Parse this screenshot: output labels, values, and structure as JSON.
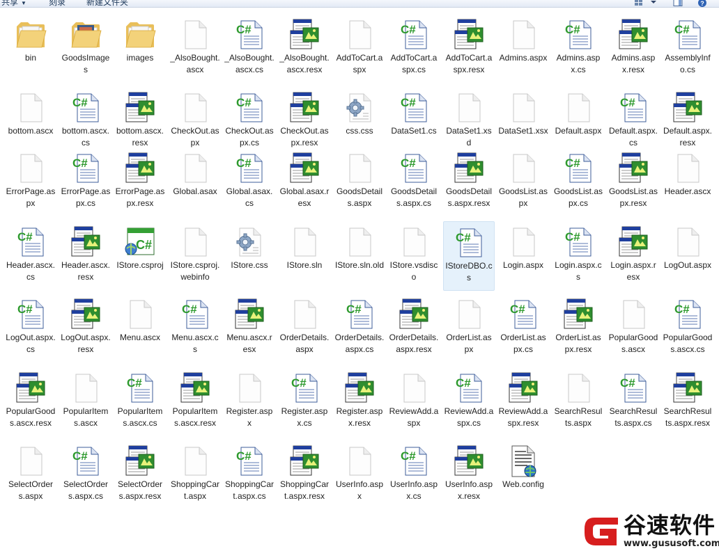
{
  "toolbar": {
    "share_label": "共享",
    "burn_label": "刻录",
    "new_folder_label": "新建文件夹"
  },
  "colors": {
    "csharp_green": "#2e9a2e",
    "resx_blue": "#1f3f9e",
    "folder_yellow": "#f3d27a",
    "selection_bg": "#e5f1fb"
  },
  "files": [
    {
      "name": "bin",
      "icon": "folder-icon"
    },
    {
      "name": "GoodsImages",
      "icon": "folder-icon"
    },
    {
      "name": "images",
      "icon": "folder-icon"
    },
    {
      "name": "_AlsoBought.ascx",
      "icon": "blank-file-icon"
    },
    {
      "name": "_AlsoBought.ascx.cs",
      "icon": "csharp-file-icon"
    },
    {
      "name": "_AlsoBought.ascx.resx",
      "icon": "resx-file-icon"
    },
    {
      "name": "AddToCart.aspx",
      "icon": "blank-file-icon"
    },
    {
      "name": "AddToCart.aspx.cs",
      "icon": "csharp-file-icon"
    },
    {
      "name": "AddToCart.aspx.resx",
      "icon": "resx-file-icon"
    },
    {
      "name": "Admins.aspx",
      "icon": "blank-file-icon"
    },
    {
      "name": "Admins.aspx.cs",
      "icon": "csharp-file-icon"
    },
    {
      "name": "Admins.aspx.resx",
      "icon": "resx-file-icon"
    },
    {
      "name": "AssemblyInfo.cs",
      "icon": "csharp-file-icon"
    },
    {
      "name": "bottom.ascx",
      "icon": "blank-file-icon"
    },
    {
      "name": "bottom.ascx.cs",
      "icon": "csharp-file-icon"
    },
    {
      "name": "bottom.ascx.resx",
      "icon": "resx-file-icon"
    },
    {
      "name": "CheckOut.aspx",
      "icon": "blank-file-icon"
    },
    {
      "name": "CheckOut.aspx.cs",
      "icon": "csharp-file-icon"
    },
    {
      "name": "CheckOut.aspx.resx",
      "icon": "resx-file-icon"
    },
    {
      "name": "css.css",
      "icon": "css-gear-icon"
    },
    {
      "name": "DataSet1.cs",
      "icon": "csharp-file-icon"
    },
    {
      "name": "DataSet1.xsd",
      "icon": "blank-file-icon"
    },
    {
      "name": "DataSet1.xsx",
      "icon": "blank-file-icon"
    },
    {
      "name": "Default.aspx",
      "icon": "blank-file-icon"
    },
    {
      "name": "Default.aspx.cs",
      "icon": "csharp-file-icon"
    },
    {
      "name": "Default.aspx.resx",
      "icon": "resx-file-icon"
    },
    {
      "name": "ErrorPage.aspx",
      "icon": "blank-file-icon"
    },
    {
      "name": "ErrorPage.aspx.cs",
      "icon": "csharp-file-icon"
    },
    {
      "name": "ErrorPage.aspx.resx",
      "icon": "resx-file-icon"
    },
    {
      "name": "Global.asax",
      "icon": "blank-file-icon"
    },
    {
      "name": "Global.asax.cs",
      "icon": "csharp-file-icon"
    },
    {
      "name": "Global.asax.resx",
      "icon": "resx-file-icon"
    },
    {
      "name": "GoodsDetails.aspx",
      "icon": "blank-file-icon"
    },
    {
      "name": "GoodsDetails.aspx.cs",
      "icon": "csharp-file-icon"
    },
    {
      "name": "GoodsDetails.aspx.resx",
      "icon": "resx-file-icon"
    },
    {
      "name": "GoodsList.aspx",
      "icon": "blank-file-icon"
    },
    {
      "name": "GoodsList.aspx.cs",
      "icon": "csharp-file-icon"
    },
    {
      "name": "GoodsList.aspx.resx",
      "icon": "resx-file-icon"
    },
    {
      "name": "Header.ascx",
      "icon": "blank-file-icon"
    },
    {
      "name": "Header.ascx.cs",
      "icon": "csharp-file-icon"
    },
    {
      "name": "Header.ascx.resx",
      "icon": "resx-file-icon"
    },
    {
      "name": "IStore.csproj",
      "icon": "csproj-icon"
    },
    {
      "name": "IStore.csproj.webinfo",
      "icon": "blank-file-icon"
    },
    {
      "name": "IStore.css",
      "icon": "css-gear-icon"
    },
    {
      "name": "IStore.sln",
      "icon": "blank-file-icon"
    },
    {
      "name": "IStore.sln.old",
      "icon": "blank-file-icon"
    },
    {
      "name": "IStore.vsdisco",
      "icon": "blank-file-icon"
    },
    {
      "name": "IStoreDBO.cs",
      "icon": "csharp-file-icon",
      "selected": true
    },
    {
      "name": "Login.aspx",
      "icon": "blank-file-icon"
    },
    {
      "name": "Login.aspx.cs",
      "icon": "csharp-file-icon"
    },
    {
      "name": "Login.aspx.resx",
      "icon": "resx-file-icon"
    },
    {
      "name": "LogOut.aspx",
      "icon": "blank-file-icon"
    },
    {
      "name": "LogOut.aspx.cs",
      "icon": "csharp-file-icon"
    },
    {
      "name": "LogOut.aspx.resx",
      "icon": "resx-file-icon"
    },
    {
      "name": "Menu.ascx",
      "icon": "blank-file-icon"
    },
    {
      "name": "Menu.ascx.cs",
      "icon": "csharp-file-icon"
    },
    {
      "name": "Menu.ascx.resx",
      "icon": "resx-file-icon"
    },
    {
      "name": "OrderDetails.aspx",
      "icon": "blank-file-icon"
    },
    {
      "name": "OrderDetails.aspx.cs",
      "icon": "csharp-file-icon"
    },
    {
      "name": "OrderDetails.aspx.resx",
      "icon": "resx-file-icon"
    },
    {
      "name": "OrderList.aspx",
      "icon": "blank-file-icon"
    },
    {
      "name": "OrderList.aspx.cs",
      "icon": "csharp-file-icon"
    },
    {
      "name": "OrderList.aspx.resx",
      "icon": "resx-file-icon"
    },
    {
      "name": "PopularGoods.ascx",
      "icon": "blank-file-icon"
    },
    {
      "name": "PopularGoods.ascx.cs",
      "icon": "csharp-file-icon"
    },
    {
      "name": "PopularGoods.ascx.resx",
      "icon": "resx-file-icon"
    },
    {
      "name": "PopularItems.ascx",
      "icon": "blank-file-icon"
    },
    {
      "name": "PopularItems.ascx.cs",
      "icon": "csharp-file-icon"
    },
    {
      "name": "PopularItems.ascx.resx",
      "icon": "resx-file-icon"
    },
    {
      "name": "Register.aspx",
      "icon": "blank-file-icon"
    },
    {
      "name": "Register.aspx.cs",
      "icon": "csharp-file-icon"
    },
    {
      "name": "Register.aspx.resx",
      "icon": "resx-file-icon"
    },
    {
      "name": "ReviewAdd.aspx",
      "icon": "blank-file-icon"
    },
    {
      "name": "ReviewAdd.aspx.cs",
      "icon": "csharp-file-icon"
    },
    {
      "name": "ReviewAdd.aspx.resx",
      "icon": "resx-file-icon"
    },
    {
      "name": "SearchResults.aspx",
      "icon": "blank-file-icon"
    },
    {
      "name": "SearchResults.aspx.cs",
      "icon": "csharp-file-icon"
    },
    {
      "name": "SearchResults.aspx.resx",
      "icon": "resx-file-icon"
    },
    {
      "name": "SelectOrders.aspx",
      "icon": "blank-file-icon"
    },
    {
      "name": "SelectOrders.aspx.cs",
      "icon": "csharp-file-icon"
    },
    {
      "name": "SelectOrders.aspx.resx",
      "icon": "resx-file-icon"
    },
    {
      "name": "ShoppingCart.aspx",
      "icon": "blank-file-icon"
    },
    {
      "name": "ShoppingCart.aspx.cs",
      "icon": "csharp-file-icon"
    },
    {
      "name": "ShoppingCart.aspx.resx",
      "icon": "resx-file-icon"
    },
    {
      "name": "UserInfo.aspx",
      "icon": "blank-file-icon"
    },
    {
      "name": "UserInfo.aspx.cs",
      "icon": "csharp-file-icon"
    },
    {
      "name": "UserInfo.aspx.resx",
      "icon": "resx-file-icon"
    },
    {
      "name": "Web.config",
      "icon": "config-file-icon"
    }
  ],
  "watermark": {
    "title": "谷速软件",
    "url": "www.gususoft.com"
  }
}
